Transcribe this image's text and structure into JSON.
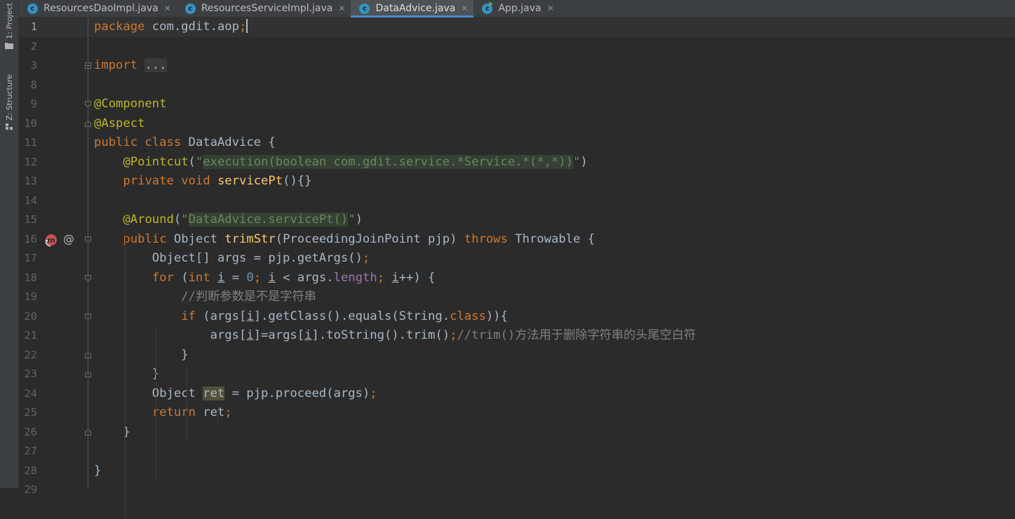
{
  "sidebar": {
    "project_label": "1: Project",
    "structure_label": "Z: Structure"
  },
  "tabs": [
    {
      "label": "ResourcesDaoImpl.java",
      "icon": "class-file-icon",
      "active": false
    },
    {
      "label": "ResourcesServiceImpl.java",
      "icon": "class-file-icon",
      "active": false
    },
    {
      "label": "DataAdvice.java",
      "icon": "class-file-icon",
      "active": true
    },
    {
      "label": "App.java",
      "icon": "runnable-class-file-icon",
      "active": false
    }
  ],
  "editor": {
    "current_line": 1,
    "lines": [
      {
        "num": "1",
        "tokens": [
          [
            "kw",
            "package"
          ],
          [
            "t",
            " com.gdit.aop"
          ],
          [
            "kw",
            ";"
          ]
        ]
      },
      {
        "num": "2",
        "tokens": []
      },
      {
        "num": "3",
        "tokens": [
          [
            "kw",
            "import"
          ],
          [
            "t",
            " "
          ],
          [
            "fold",
            "..."
          ]
        ]
      },
      {
        "num": "8",
        "tokens": []
      },
      {
        "num": "9",
        "tokens": [
          [
            "ann",
            "@Component"
          ]
        ]
      },
      {
        "num": "10",
        "tokens": [
          [
            "ann",
            "@Aspect"
          ]
        ]
      },
      {
        "num": "11",
        "tokens": [
          [
            "kw",
            "public class"
          ],
          [
            "t",
            " DataAdvice {"
          ]
        ]
      },
      {
        "num": "12",
        "tokens": [
          [
            "t",
            "    "
          ],
          [
            "ann",
            "@Pointcut"
          ],
          [
            "t",
            "("
          ],
          [
            "str",
            "\""
          ],
          [
            "str hl",
            "execution(boolean com.gdit.service.*Service.*(*,*))"
          ],
          [
            "str",
            "\""
          ],
          [
            "t",
            ")"
          ]
        ]
      },
      {
        "num": "13",
        "tokens": [
          [
            "t",
            "    "
          ],
          [
            "kw",
            "private void"
          ],
          [
            "t",
            " "
          ],
          [
            "fn",
            "servicePt"
          ],
          [
            "t",
            "(){}"
          ]
        ]
      },
      {
        "num": "14",
        "tokens": []
      },
      {
        "num": "15",
        "tokens": [
          [
            "t",
            "    "
          ],
          [
            "ann",
            "@Around"
          ],
          [
            "t",
            "("
          ],
          [
            "str",
            "\""
          ],
          [
            "str hl",
            "DataAdvice.servicePt()"
          ],
          [
            "str",
            "\""
          ],
          [
            "t",
            ")"
          ]
        ]
      },
      {
        "num": "16",
        "tokens": [
          [
            "t",
            "    "
          ],
          [
            "kw",
            "public"
          ],
          [
            "t",
            " Object "
          ],
          [
            "fn",
            "trimStr"
          ],
          [
            "t",
            "(ProceedingJoinPoint pjp) "
          ],
          [
            "kw",
            "throws"
          ],
          [
            "t",
            " Throwable {"
          ]
        ]
      },
      {
        "num": "17",
        "tokens": [
          [
            "t",
            "        Object[] args = pjp.getArgs()"
          ],
          [
            "kw",
            ";"
          ]
        ]
      },
      {
        "num": "18",
        "tokens": [
          [
            "t",
            "        "
          ],
          [
            "kw",
            "for"
          ],
          [
            "t",
            " ("
          ],
          [
            "kw",
            "int"
          ],
          [
            "t",
            " "
          ],
          [
            "ul",
            "i"
          ],
          [
            "t",
            " = "
          ],
          [
            "num",
            "0"
          ],
          [
            "kw",
            ";"
          ],
          [
            "t",
            " "
          ],
          [
            "ul",
            "i"
          ],
          [
            "t",
            " < args."
          ],
          [
            "fld",
            "length"
          ],
          [
            "kw",
            ";"
          ],
          [
            "t",
            " "
          ],
          [
            "ul",
            "i"
          ],
          [
            "t",
            "++) {"
          ]
        ]
      },
      {
        "num": "19",
        "tokens": [
          [
            "t",
            "            "
          ],
          [
            "cmt",
            "//判断参数是不是字符串"
          ]
        ]
      },
      {
        "num": "20",
        "tokens": [
          [
            "t",
            "            "
          ],
          [
            "kw",
            "if"
          ],
          [
            "t",
            " (args["
          ],
          [
            "ul",
            "i"
          ],
          [
            "t",
            "].getClass().equals(String."
          ],
          [
            "kw",
            "class"
          ],
          [
            "t",
            "))"
          ],
          [
            "t",
            "{"
          ]
        ]
      },
      {
        "num": "21",
        "tokens": [
          [
            "t",
            "                args["
          ],
          [
            "ul",
            "i"
          ],
          [
            "t",
            "]=args["
          ],
          [
            "ul",
            "i"
          ],
          [
            "t",
            "].toString().trim()"
          ],
          [
            "kw",
            ";"
          ],
          [
            "cmt",
            "//trim()方法用于删除字符串的头尾空白符"
          ]
        ]
      },
      {
        "num": "22",
        "tokens": [
          [
            "t",
            "            }"
          ]
        ]
      },
      {
        "num": "23",
        "tokens": [
          [
            "t",
            "        }"
          ]
        ]
      },
      {
        "num": "24",
        "tokens": [
          [
            "t",
            "        Object "
          ],
          [
            "hlv",
            "ret"
          ],
          [
            "t",
            " = pjp.proceed(args)"
          ],
          [
            "kw",
            ";"
          ]
        ]
      },
      {
        "num": "25",
        "tokens": [
          [
            "t",
            "        "
          ],
          [
            "kw",
            "return"
          ],
          [
            "t",
            " ret"
          ],
          [
            "kw",
            ";"
          ]
        ]
      },
      {
        "num": "26",
        "tokens": [
          [
            "t",
            "    }"
          ]
        ]
      },
      {
        "num": "27",
        "tokens": []
      },
      {
        "num": "28",
        "tokens": [
          [
            "t",
            "}"
          ]
        ]
      },
      {
        "num": "29",
        "tokens": []
      }
    ],
    "fold_lines": [
      "3",
      "9",
      "10",
      "16",
      "18",
      "20",
      "22",
      "23",
      "26"
    ],
    "fold_end_lines": [
      "10",
      "22",
      "23",
      "26"
    ],
    "gutter_icons": [
      {
        "line": "16",
        "icon": "around-advice-icon"
      },
      {
        "line": "16",
        "icon": "annotation-at-icon",
        "glyph": "@"
      }
    ]
  }
}
